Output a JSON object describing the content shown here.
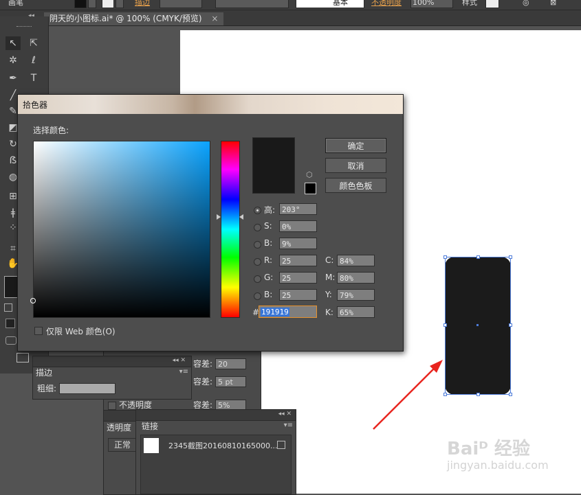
{
  "control_bar": {
    "left_label": "画笔",
    "stroke_label": "描边",
    "style_basic": "基本",
    "opacity_label": "不透明度",
    "opacity_value": "100%",
    "style_label": "样式"
  },
  "document_tab": {
    "title": "阴天的小图标.ai* @ 100% (CMYK/预览)",
    "close": "×"
  },
  "panels": {
    "tolerance_label": "容差:",
    "tolerance_values": [
      "20",
      "5 pt",
      "5%"
    ],
    "stroke_panel_title": "描边",
    "weight_label": "粗细:",
    "opacity_check_label": "不透明度",
    "transparency_title": "透明度",
    "blend_mode": "正常",
    "links_title": "链接",
    "link_file": "2345截图20160810165000..."
  },
  "color_picker": {
    "title": "拾色器",
    "select_color_label": "选择颜色:",
    "buttons": {
      "ok": "确定",
      "cancel": "取消",
      "swatches": "颜色色板"
    },
    "hsb": [
      {
        "label": "H:",
        "display": "高:",
        "value": "203°",
        "selected": true
      },
      {
        "label": "S:",
        "display": "S:",
        "value": "0%",
        "selected": false
      },
      {
        "label": "B:",
        "display": "B:",
        "value": "9%",
        "selected": false
      }
    ],
    "rgb": [
      {
        "label": "R:",
        "value": "25"
      },
      {
        "label": "G:",
        "value": "25"
      },
      {
        "label": "B:",
        "value": "25"
      }
    ],
    "cmyk": [
      {
        "label": "C:",
        "value": "84%"
      },
      {
        "label": "M:",
        "value": "80%"
      },
      {
        "label": "Y:",
        "value": "79%"
      },
      {
        "label": "K:",
        "value": "65%"
      }
    ],
    "hex_prefix": "#",
    "hex_value": "191919",
    "web_only_label": "仅限 Web 颜色(O)",
    "current_color": "#191919",
    "hue_field_color": "#0aa3ff"
  },
  "watermark": {
    "brand": "Baiᴰ 经验",
    "url": "jingyan.baidu.com"
  }
}
